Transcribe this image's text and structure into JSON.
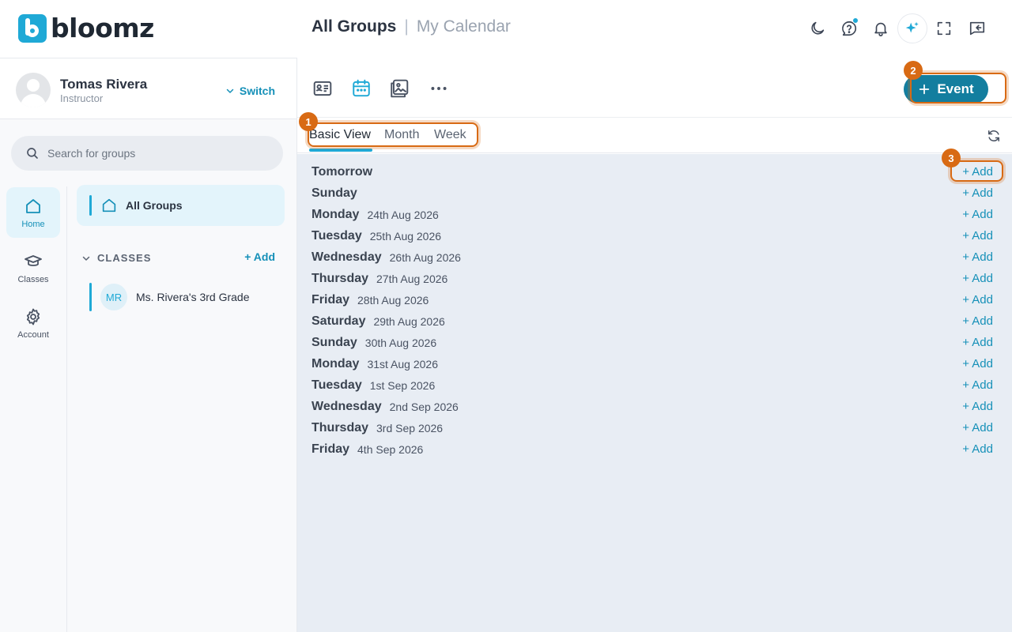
{
  "app": {
    "logo_text": "bloomz",
    "brand_color": "#1fa9d6",
    "accent_dark": "#137e9f"
  },
  "header": {
    "breadcrumb_active": "All Groups",
    "breadcrumb_separator": "|",
    "breadcrumb_inactive": "My Calendar",
    "icons": [
      "dark-mode-icon",
      "help-chat-icon",
      "bell-icon",
      "ai-sparkle-icon",
      "fullscreen-icon",
      "feedback-icon"
    ],
    "notification_dot_color": "#1fa9d6"
  },
  "user": {
    "name": "Tomas Rivera",
    "role": "Instructor",
    "switch_label": "Switch"
  },
  "search": {
    "placeholder": "Search for groups",
    "value": ""
  },
  "rail": [
    {
      "label": "Home",
      "icon": "home-icon",
      "active": true
    },
    {
      "label": "Classes",
      "icon": "graduation-cap-icon",
      "active": false
    },
    {
      "label": "Account",
      "icon": "gear-icon",
      "active": false
    }
  ],
  "groups": {
    "all_groups_label": "All Groups",
    "classes_header": "CLASSES",
    "add_label": "Add",
    "classes": [
      {
        "initials": "MR",
        "name": "Ms. Rivera's 3rd Grade"
      }
    ]
  },
  "toolbar": {
    "icons": [
      "feed-icon",
      "calendar-icon",
      "gallery-icon",
      "more-icon"
    ],
    "active_icon": "calendar-icon",
    "event_button": "Event"
  },
  "tabs": [
    {
      "label": "Basic View",
      "active": true
    },
    {
      "label": "Month",
      "active": false
    },
    {
      "label": "Week",
      "active": false
    }
  ],
  "calendar": {
    "add_label": "+ Add",
    "days": [
      {
        "name": "Tomorrow",
        "date": ""
      },
      {
        "name": "Sunday",
        "date": ""
      },
      {
        "name": "Monday",
        "date": "24th Aug 2026"
      },
      {
        "name": "Tuesday",
        "date": "25th Aug 2026"
      },
      {
        "name": "Wednesday",
        "date": "26th Aug 2026"
      },
      {
        "name": "Thursday",
        "date": "27th Aug 2026"
      },
      {
        "name": "Friday",
        "date": "28th Aug 2026"
      },
      {
        "name": "Saturday",
        "date": "29th Aug 2026"
      },
      {
        "name": "Sunday",
        "date": "30th Aug 2026"
      },
      {
        "name": "Monday",
        "date": "31st Aug 2026"
      },
      {
        "name": "Tuesday",
        "date": "1st Sep 2026"
      },
      {
        "name": "Wednesday",
        "date": "2nd Sep 2026"
      },
      {
        "name": "Thursday",
        "date": "3rd Sep 2026"
      },
      {
        "name": "Friday",
        "date": "4th Sep 2026"
      }
    ]
  },
  "annotations": [
    {
      "number": "1"
    },
    {
      "number": "2"
    },
    {
      "number": "3"
    }
  ],
  "annotation_color": "#d86a14"
}
